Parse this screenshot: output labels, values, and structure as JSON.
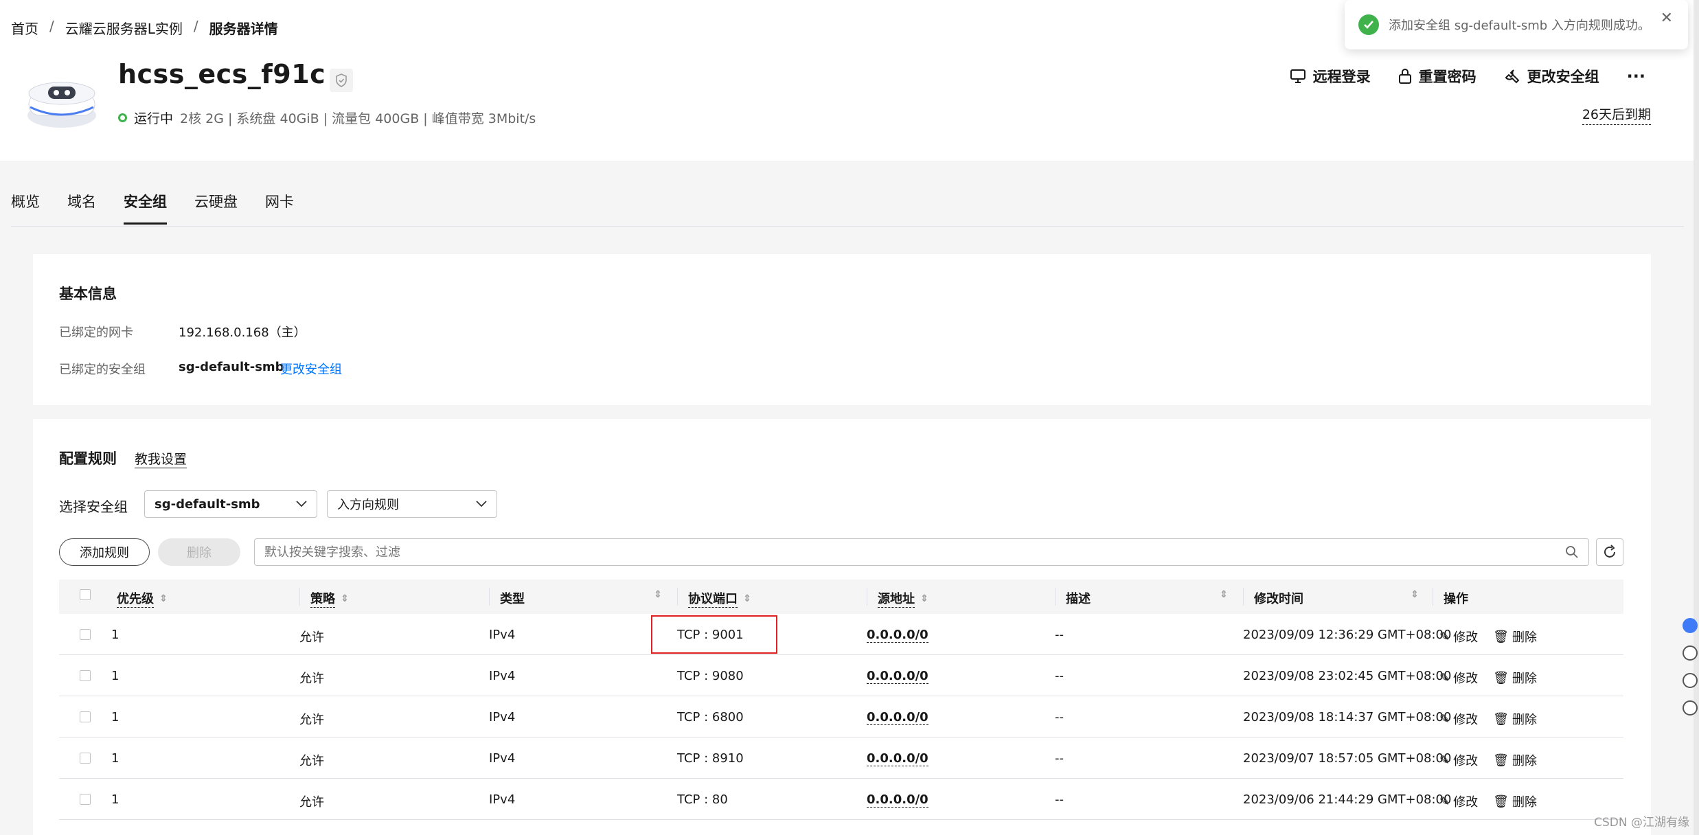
{
  "breadcrumb": {
    "items": [
      "首页",
      "云耀云服务器L实例",
      "服务器详情"
    ],
    "separator": "/"
  },
  "server": {
    "name": "hcss_ecs_f91c",
    "status": "运行中",
    "specs": "2核  2G | 系统盘 40GiB | 流量包 400GB | 峰值带宽 3Mbit/s",
    "expire": "26天后到期"
  },
  "actions": {
    "remote_login": "远程登录",
    "reset_password": "重置密码",
    "change_security_group": "更改安全组",
    "more": "···"
  },
  "toast": {
    "message": "添加安全组 sg-default-smb 入方向规则成功。"
  },
  "tabs": [
    "概览",
    "域名",
    "安全组",
    "云硬盘",
    "网卡"
  ],
  "active_tab": "安全组",
  "basic_info": {
    "title": "基本信息",
    "nic_label": "已绑定的网卡",
    "nic_value": "192.168.0.168（主）",
    "sg_label": "已绑定的安全组",
    "sg_value": "sg-default-smb",
    "change_sg_link": "更改安全组"
  },
  "rules": {
    "title": "配置规则",
    "teach_link": "教我设置",
    "select_label": "选择安全组",
    "select_group": "sg-default-smb",
    "select_direction": "入方向规则",
    "add_button": "添加规则",
    "delete_button": "删除",
    "search_placeholder": "默认按关键字搜索、过滤",
    "columns": [
      "优先级",
      "策略",
      "类型",
      "协议端口",
      "源地址",
      "描述",
      "修改时间",
      "操作"
    ],
    "rows": [
      {
        "priority": "1",
        "policy": "允许",
        "type": "IPv4",
        "port": "TCP : 9001",
        "source": "0.0.0.0/0",
        "desc": "--",
        "time": "2023/09/09 12:36:29 GMT+08:00"
      },
      {
        "priority": "1",
        "policy": "允许",
        "type": "IPv4",
        "port": "TCP : 9080",
        "source": "0.0.0.0/0",
        "desc": "--",
        "time": "2023/09/08 23:02:45 GMT+08:00"
      },
      {
        "priority": "1",
        "policy": "允许",
        "type": "IPv4",
        "port": "TCP : 6800",
        "source": "0.0.0.0/0",
        "desc": "--",
        "time": "2023/09/08 18:14:37 GMT+08:00"
      },
      {
        "priority": "1",
        "policy": "允许",
        "type": "IPv4",
        "port": "TCP : 8910",
        "source": "0.0.0.0/0",
        "desc": "--",
        "time": "2023/09/07 18:57:05 GMT+08:00"
      },
      {
        "priority": "1",
        "policy": "允许",
        "type": "IPv4",
        "port": "TCP : 80",
        "source": "0.0.0.0/0",
        "desc": "--",
        "time": "2023/09/06 21:44:29 GMT+08:00"
      }
    ],
    "edit_label": "修改",
    "delete_label": "删除"
  },
  "watermark": "CSDN @江湖有缘",
  "colors": {
    "success": "#3fb24b",
    "link": "#0077ff",
    "highlight": "#e02020"
  }
}
